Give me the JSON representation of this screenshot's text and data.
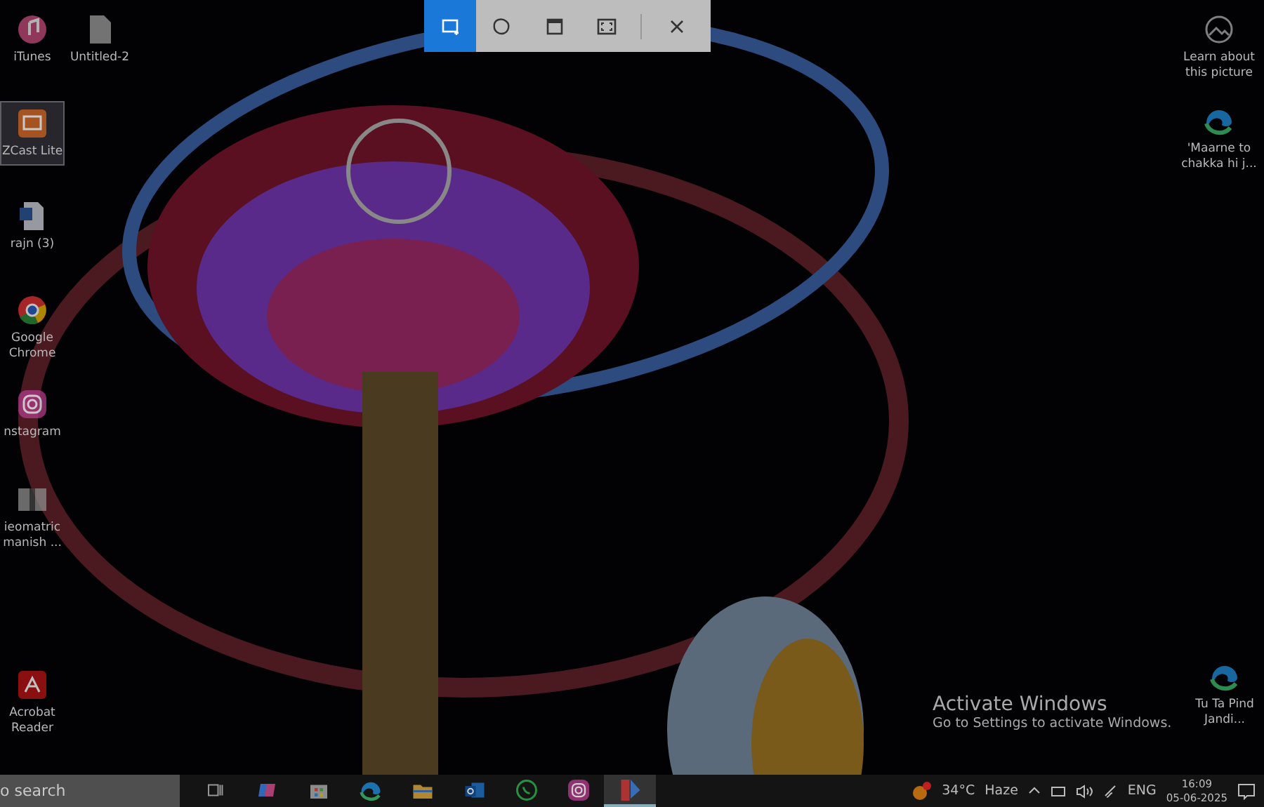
{
  "desktop_icons": [
    {
      "label": "iTunes",
      "kind": "music",
      "selected": false
    },
    {
      "label": "Untitled-2",
      "kind": "file",
      "selected": false
    },
    {
      "label": "ZCast Lite",
      "kind": "cast",
      "selected": true
    },
    {
      "label": "rajn (3)",
      "kind": "document",
      "selected": false
    },
    {
      "label": "Google Chrome",
      "kind": "browser",
      "selected": false
    },
    {
      "label": "nstagram",
      "kind": "camera",
      "selected": false
    },
    {
      "label": "ieomatric manish ...",
      "kind": "image",
      "selected": false
    },
    {
      "label": "Acrobat Reader",
      "kind": "pdf",
      "selected": false
    },
    {
      "label": "Learn about this picture",
      "kind": "picture",
      "selected": false
    },
    {
      "label": "'Maarne to chakka hi j...",
      "kind": "web",
      "selected": false
    },
    {
      "label": "Tu Ta Pind Jandi...",
      "kind": "web",
      "selected": false
    }
  ],
  "snip_toolbar": {
    "modes": [
      {
        "kind": "rectangle",
        "selected": true
      },
      {
        "kind": "freeform",
        "selected": false
      },
      {
        "kind": "window",
        "selected": false
      },
      {
        "kind": "fullscreen",
        "selected": false
      }
    ]
  },
  "activation_notice": {
    "title": "Activate Windows",
    "message": "Go to Settings to activate Windows."
  },
  "taskbar": {
    "search": {
      "placeholder": "o search"
    },
    "apps": [
      {
        "kind": "taskview",
        "active": false
      },
      {
        "kind": "assistant",
        "active": false
      },
      {
        "kind": "store",
        "active": false
      },
      {
        "kind": "web",
        "active": false
      },
      {
        "kind": "folder",
        "active": false
      },
      {
        "kind": "mail",
        "active": false
      },
      {
        "kind": "chat",
        "active": false
      },
      {
        "kind": "camera",
        "active": false
      },
      {
        "kind": "app",
        "active": true
      }
    ],
    "weather": {
      "temperature": "34°C",
      "condition": "Haze"
    },
    "language": "ENG",
    "time": "16:09",
    "date": "05-06-2025"
  }
}
